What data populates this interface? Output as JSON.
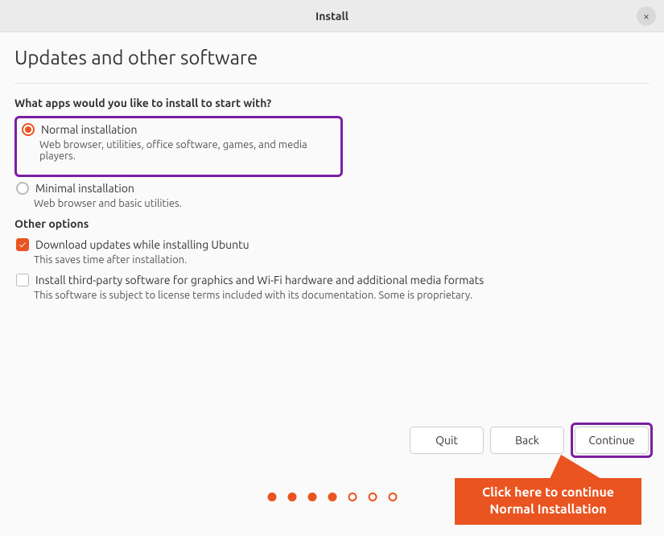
{
  "titlebar": {
    "title": "Install",
    "close_label": "×"
  },
  "page": {
    "heading": "Updates and other software"
  },
  "apps_section": {
    "question": "What apps would you like to install to start with?",
    "normal": {
      "label": "Normal installation",
      "desc": "Web browser, utilities, office software, games, and media players.",
      "selected": true
    },
    "minimal": {
      "label": "Minimal installation",
      "desc": "Web browser and basic utilities.",
      "selected": false
    }
  },
  "other_section": {
    "heading": "Other options",
    "download_updates": {
      "label": "Download updates while installing Ubuntu",
      "desc": "This saves time after installation.",
      "checked": true
    },
    "third_party": {
      "label": "Install third-party software for graphics and Wi-Fi hardware and additional media formats",
      "desc": "This software is subject to license terms included with its documentation. Some is proprietary.",
      "checked": false
    }
  },
  "buttons": {
    "quit": "Quit",
    "back": "Back",
    "continue": "Continue"
  },
  "callout": {
    "line1": "Click here to continue",
    "line2": "Normal Installation"
  },
  "progress": {
    "total": 7,
    "current": 4
  }
}
